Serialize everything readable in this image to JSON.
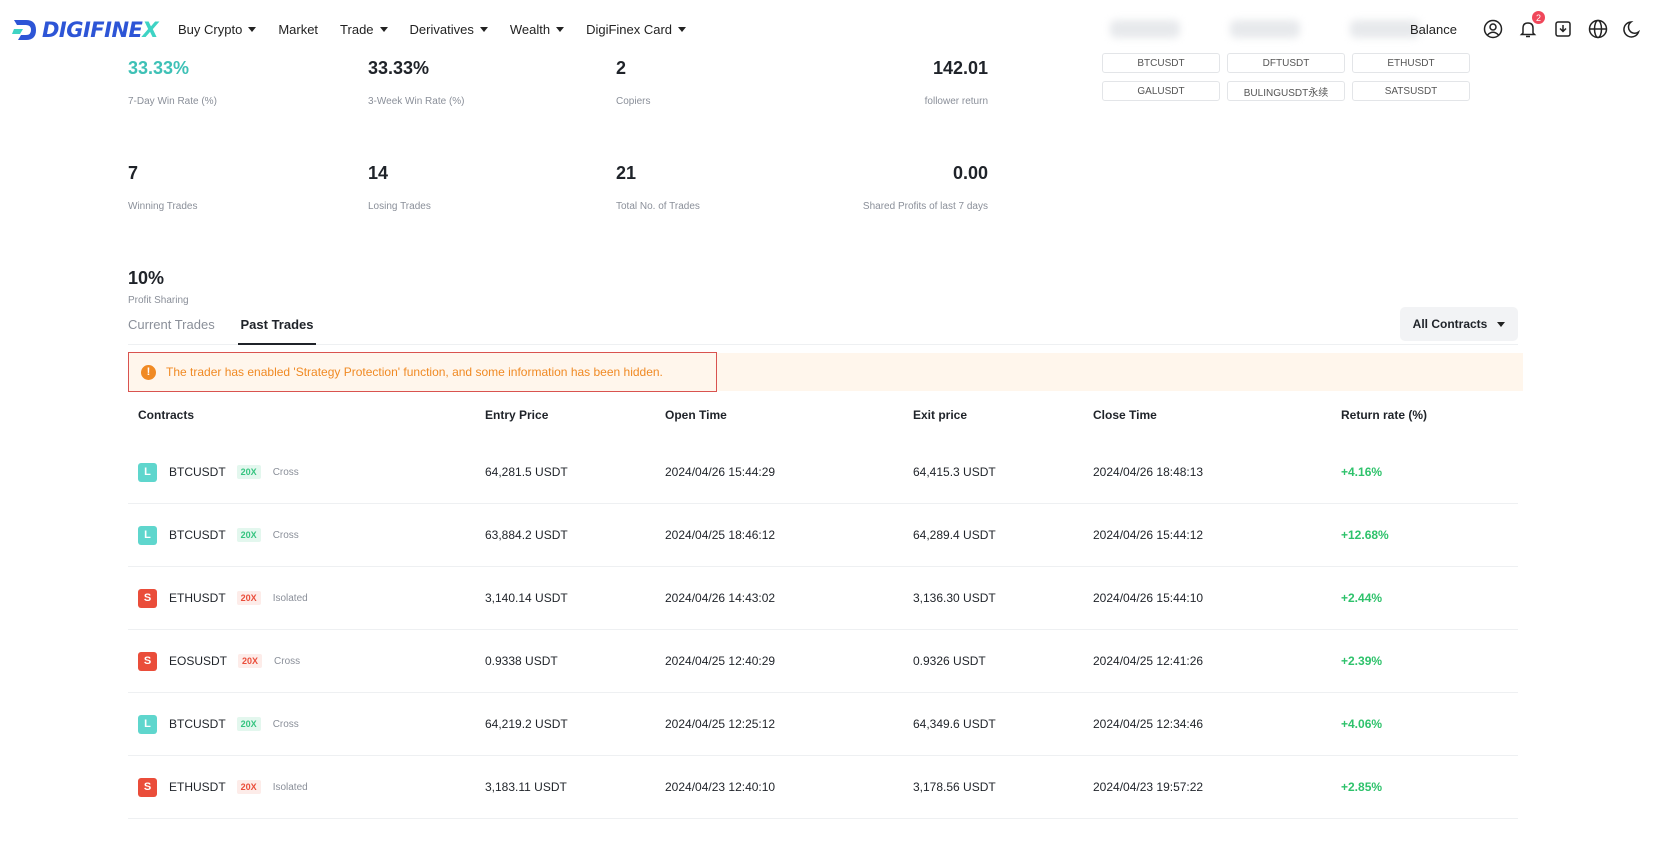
{
  "header": {
    "logo_text_main": "DIGIFINE",
    "logo_text_x": "X",
    "nav": [
      {
        "label": "Buy Crypto",
        "dropdown": true
      },
      {
        "label": "Market",
        "dropdown": false
      },
      {
        "label": "Trade",
        "dropdown": true
      },
      {
        "label": "Derivatives",
        "dropdown": true
      },
      {
        "label": "Wealth",
        "dropdown": true
      },
      {
        "label": "DigiFinex Card",
        "dropdown": true
      }
    ],
    "balance_label": "Balance",
    "notification_count": "2",
    "icons": [
      "user-icon",
      "bell-icon",
      "download-icon",
      "globe-icon",
      "moon-icon"
    ]
  },
  "stats": {
    "win_rate_7d": {
      "value": "33.33%",
      "label": "7-Day Win Rate (%)"
    },
    "win_rate_3w": {
      "value": "33.33%",
      "label": "3-Week Win Rate (%)"
    },
    "copiers": {
      "value": "2",
      "label": "Copiers"
    },
    "follower_return": {
      "value": "142.01",
      "label": "follower return"
    },
    "winning_trades": {
      "value": "7",
      "label": "Winning Trades"
    },
    "losing_trades": {
      "value": "14",
      "label": "Losing Trades"
    },
    "total_trades": {
      "value": "21",
      "label": "Total No. of Trades"
    },
    "shared_profits": {
      "value": "0.00",
      "label": "Shared Profits of last 7 days"
    },
    "profit_sharing": {
      "value": "10%",
      "label": "Profit Sharing"
    }
  },
  "contract_chips": [
    "BTCUSDT",
    "DFTUSDT",
    "ETHUSDT",
    "GALUSDT",
    "BULINGUSDT永续",
    "SATSUSDT"
  ],
  "tabs": {
    "current": "Current Trades",
    "past": "Past Trades",
    "active": "past"
  },
  "filter": {
    "selected": "All Contracts"
  },
  "notice": {
    "icon": "!",
    "text": "The trader has enabled 'Strategy Protection' function, and some information has been hidden."
  },
  "table": {
    "headers": {
      "contracts": "Contracts",
      "entry_price": "Entry Price",
      "open_time": "Open Time",
      "exit_price": "Exit price",
      "close_time": "Close Time",
      "return_rate": "Return rate (%)"
    },
    "rows": [
      {
        "side": "L",
        "direction": "long",
        "symbol": "BTCUSDT",
        "leverage": "20X",
        "mode": "Cross",
        "entry": "64,281.5 USDT",
        "open": "2024/04/26 15:44:29",
        "exit": "64,415.3 USDT",
        "close": "2024/04/26 18:48:13",
        "ret": "+4.16%"
      },
      {
        "side": "L",
        "direction": "long",
        "symbol": "BTCUSDT",
        "leverage": "20X",
        "mode": "Cross",
        "entry": "63,884.2 USDT",
        "open": "2024/04/25 18:46:12",
        "exit": "64,289.4 USDT",
        "close": "2024/04/26 15:44:12",
        "ret": "+12.68%"
      },
      {
        "side": "S",
        "direction": "short",
        "symbol": "ETHUSDT",
        "leverage": "20X",
        "mode": "Isolated",
        "entry": "3,140.14 USDT",
        "open": "2024/04/26 14:43:02",
        "exit": "3,136.30 USDT",
        "close": "2024/04/26 15:44:10",
        "ret": "+2.44%"
      },
      {
        "side": "S",
        "direction": "short",
        "symbol": "EOSUSDT",
        "leverage": "20X",
        "mode": "Cross",
        "entry": "0.9338 USDT",
        "open": "2024/04/25 12:40:29",
        "exit": "0.9326 USDT",
        "close": "2024/04/25 12:41:26",
        "ret": "+2.39%"
      },
      {
        "side": "L",
        "direction": "long",
        "symbol": "BTCUSDT",
        "leverage": "20X",
        "mode": "Cross",
        "entry": "64,219.2 USDT",
        "open": "2024/04/25 12:25:12",
        "exit": "64,349.6 USDT",
        "close": "2024/04/25 12:34:46",
        "ret": "+4.06%"
      },
      {
        "side": "S",
        "direction": "short",
        "symbol": "ETHUSDT",
        "leverage": "20X",
        "mode": "Isolated",
        "entry": "3,183.11 USDT",
        "open": "2024/04/23 12:40:10",
        "exit": "3,178.56 USDT",
        "close": "2024/04/23 19:57:22",
        "ret": "+2.85%"
      }
    ]
  },
  "colors": {
    "brand_blue": "#2d55d6",
    "brand_teal": "#3ed3c4",
    "positive": "#2ec26b",
    "short": "#ea4d3a",
    "long": "#5fd6cd",
    "notice": "#f08a24"
  }
}
